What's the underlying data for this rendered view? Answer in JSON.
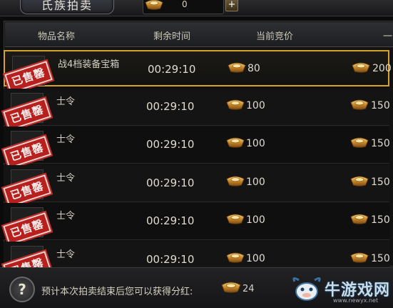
{
  "title": "氏族拍卖",
  "currency": {
    "icon": "gold-ingot-icon",
    "value": "0",
    "add_label": "+"
  },
  "headers": {
    "item_name": "物品名称",
    "time_left": "剩余时间",
    "current_bid": "当前竞价",
    "buyout": "一"
  },
  "rows": [
    {
      "name": "战4档装备宝箱",
      "stamp": "已售罄",
      "time": "00:29:10",
      "bid": "80",
      "buyout": "200"
    },
    {
      "name": "士令",
      "stamp": "已售罄",
      "time": "00:29:10",
      "bid": "100",
      "buyout": "150"
    },
    {
      "name": "士令",
      "stamp": "已售罄",
      "time": "00:29:10",
      "bid": "100",
      "buyout": "150"
    },
    {
      "name": "士令",
      "stamp": "已售罄",
      "time": "00:29:10",
      "bid": "100",
      "buyout": "150"
    },
    {
      "name": "士令",
      "stamp": "已售罄",
      "time": "00:29:10",
      "bid": "100",
      "buyout": "150"
    },
    {
      "name": "士令",
      "stamp": "已售罄",
      "time": "00:29:10",
      "bid": "100",
      "buyout": "150"
    }
  ],
  "footer": {
    "help_label": "?",
    "info_text": "预计本次拍卖结束后您可以获得分红:",
    "dividend": "24"
  },
  "watermark": {
    "text": "牛游戏网",
    "url": "www.newyx.net"
  },
  "colors": {
    "accent": "#d7a22a",
    "stamp_red": "#b8201d"
  }
}
